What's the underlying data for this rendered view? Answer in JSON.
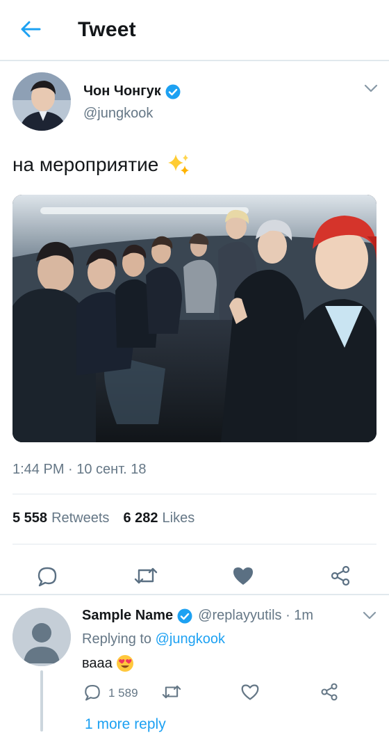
{
  "header": {
    "title": "Tweet",
    "back_icon": "arrow-left-icon",
    "accent": "#1da1f2"
  },
  "tweet": {
    "display_name": "Чон Чонгук",
    "handle": "@jungkook",
    "text": "на мероприятие",
    "timestamp": "1:44 PM · 10 сент. 18",
    "retweets_count": "5 558",
    "retweets_label": "Retweets",
    "likes_count": "6 282",
    "likes_label": "Likes",
    "icons": [
      "reply-icon",
      "retweet-icon",
      "heart-filled-icon",
      "share-icon"
    ]
  },
  "reply": {
    "display_name": "Sample Name",
    "meta": "@replayyutils · 1m",
    "replying_prefix": "Replying to",
    "replying_mention": "@jungkook",
    "text": "ваaa",
    "reply_count": "1 589",
    "more_replies": "1 more reply",
    "icons": [
      "reply-icon",
      "retweet-icon",
      "heart-outline-icon",
      "share-icon"
    ]
  },
  "colors": {
    "primary_text": "#14171a",
    "secondary_text": "#657786",
    "link": "#1da1f2",
    "divider": "#e1e8ed",
    "icon": "#5b7083"
  }
}
